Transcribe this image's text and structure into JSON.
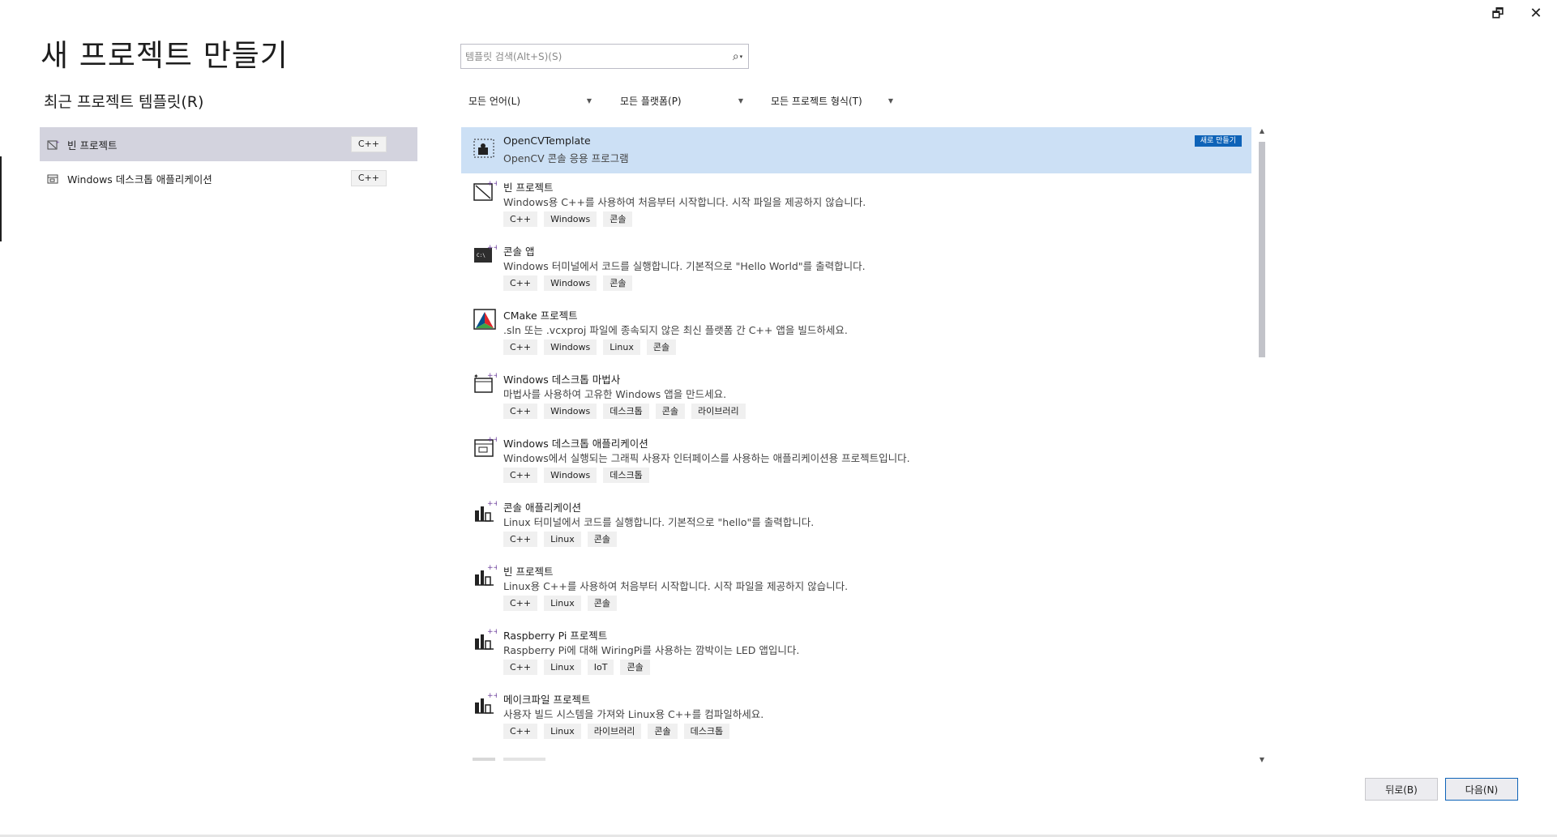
{
  "window": {
    "restore_glyph": "🗗",
    "close_glyph": "✕"
  },
  "page_title": "새 프로젝트 만들기",
  "recent": {
    "title": "최근 프로젝트 템플릿(R)",
    "items": [
      {
        "label": "빈 프로젝트",
        "tag": "C++",
        "icon": "empty-project-icon",
        "selected": true
      },
      {
        "label": "Windows 데스크톱 애플리케이션",
        "tag": "C++",
        "icon": "desktop-app-icon",
        "selected": false
      }
    ]
  },
  "search": {
    "placeholder": "템플릿 검색(Alt+S)(S)",
    "value": "",
    "icon": "search-icon"
  },
  "filters": {
    "language": "모든 언어(L)",
    "platform": "모든 플랫폼(P)",
    "type": "모든 프로젝트 형식(T)"
  },
  "templates": [
    {
      "title": "OpenCVTemplate",
      "description": "OpenCV 콘솔 응용 프로그램",
      "tags": [],
      "badge": "새로 만들기",
      "icon": "opencv-template-icon",
      "selected": true
    },
    {
      "title": "빈 프로젝트",
      "description": "Windows용 C++를 사용하여 처음부터 시작합니다. 시작 파일을 제공하지 않습니다.",
      "tags": [
        "C++",
        "Windows",
        "콘솔"
      ],
      "icon": "empty-project-icon"
    },
    {
      "title": "콘솔 앱",
      "description": "Windows 터미널에서 코드를 실행합니다. 기본적으로 \"Hello World\"를 출력합니다.",
      "tags": [
        "C++",
        "Windows",
        "콘솔"
      ],
      "icon": "console-app-icon"
    },
    {
      "title": "CMake 프로젝트",
      "description": ".sln 또는 .vcxproj 파일에 종속되지 않은 최신 플랫폼 간 C++ 앱을 빌드하세요.",
      "tags": [
        "C++",
        "Windows",
        "Linux",
        "콘솔"
      ],
      "icon": "cmake-icon"
    },
    {
      "title": "Windows 데스크톱 마법사",
      "description": "마법사를 사용하여 고유한 Windows 앱을 만드세요.",
      "tags": [
        "C++",
        "Windows",
        "데스크톱",
        "콘솔",
        "라이브러리"
      ],
      "icon": "desktop-wizard-icon"
    },
    {
      "title": "Windows 데스크톱 애플리케이션",
      "description": "Windows에서 실행되는 그래픽 사용자 인터페이스를 사용하는 애플리케이션용 프로젝트입니다.",
      "tags": [
        "C++",
        "Windows",
        "데스크톱"
      ],
      "icon": "desktop-app-icon"
    },
    {
      "title": "콘솔 애플리케이션",
      "description": "Linux 터미널에서 코드를 실행합니다. 기본적으로 \"hello\"를 출력합니다.",
      "tags": [
        "C++",
        "Linux",
        "콘솔"
      ],
      "icon": "linux-project-icon"
    },
    {
      "title": "빈 프로젝트",
      "description": "Linux용 C++를 사용하여 처음부터 시작합니다. 시작 파일을 제공하지 않습니다.",
      "tags": [
        "C++",
        "Linux",
        "콘솔"
      ],
      "icon": "linux-project-icon"
    },
    {
      "title": "Raspberry Pi 프로젝트",
      "description": "Raspberry Pi에 대해 WiringPi를 사용하는 깜박이는 LED 앱입니다.",
      "tags": [
        "C++",
        "Linux",
        "IoT",
        "콘솔"
      ],
      "icon": "linux-project-icon"
    },
    {
      "title": "메이크파일 프로젝트",
      "description": "사용자 빌드 시스템을 가져와 Linux용 C++를 컴파일하세요.",
      "tags": [
        "C++",
        "Linux",
        "라이브러리",
        "콘솔",
        "데스크톱"
      ],
      "icon": "linux-project-icon"
    }
  ],
  "buttons": {
    "back": "뒤로(B)",
    "next": "다음(N)"
  },
  "colors": {
    "selected_row": "#cce0f5",
    "recent_selected": "#d3d3de",
    "accent": "#0e63b8"
  }
}
